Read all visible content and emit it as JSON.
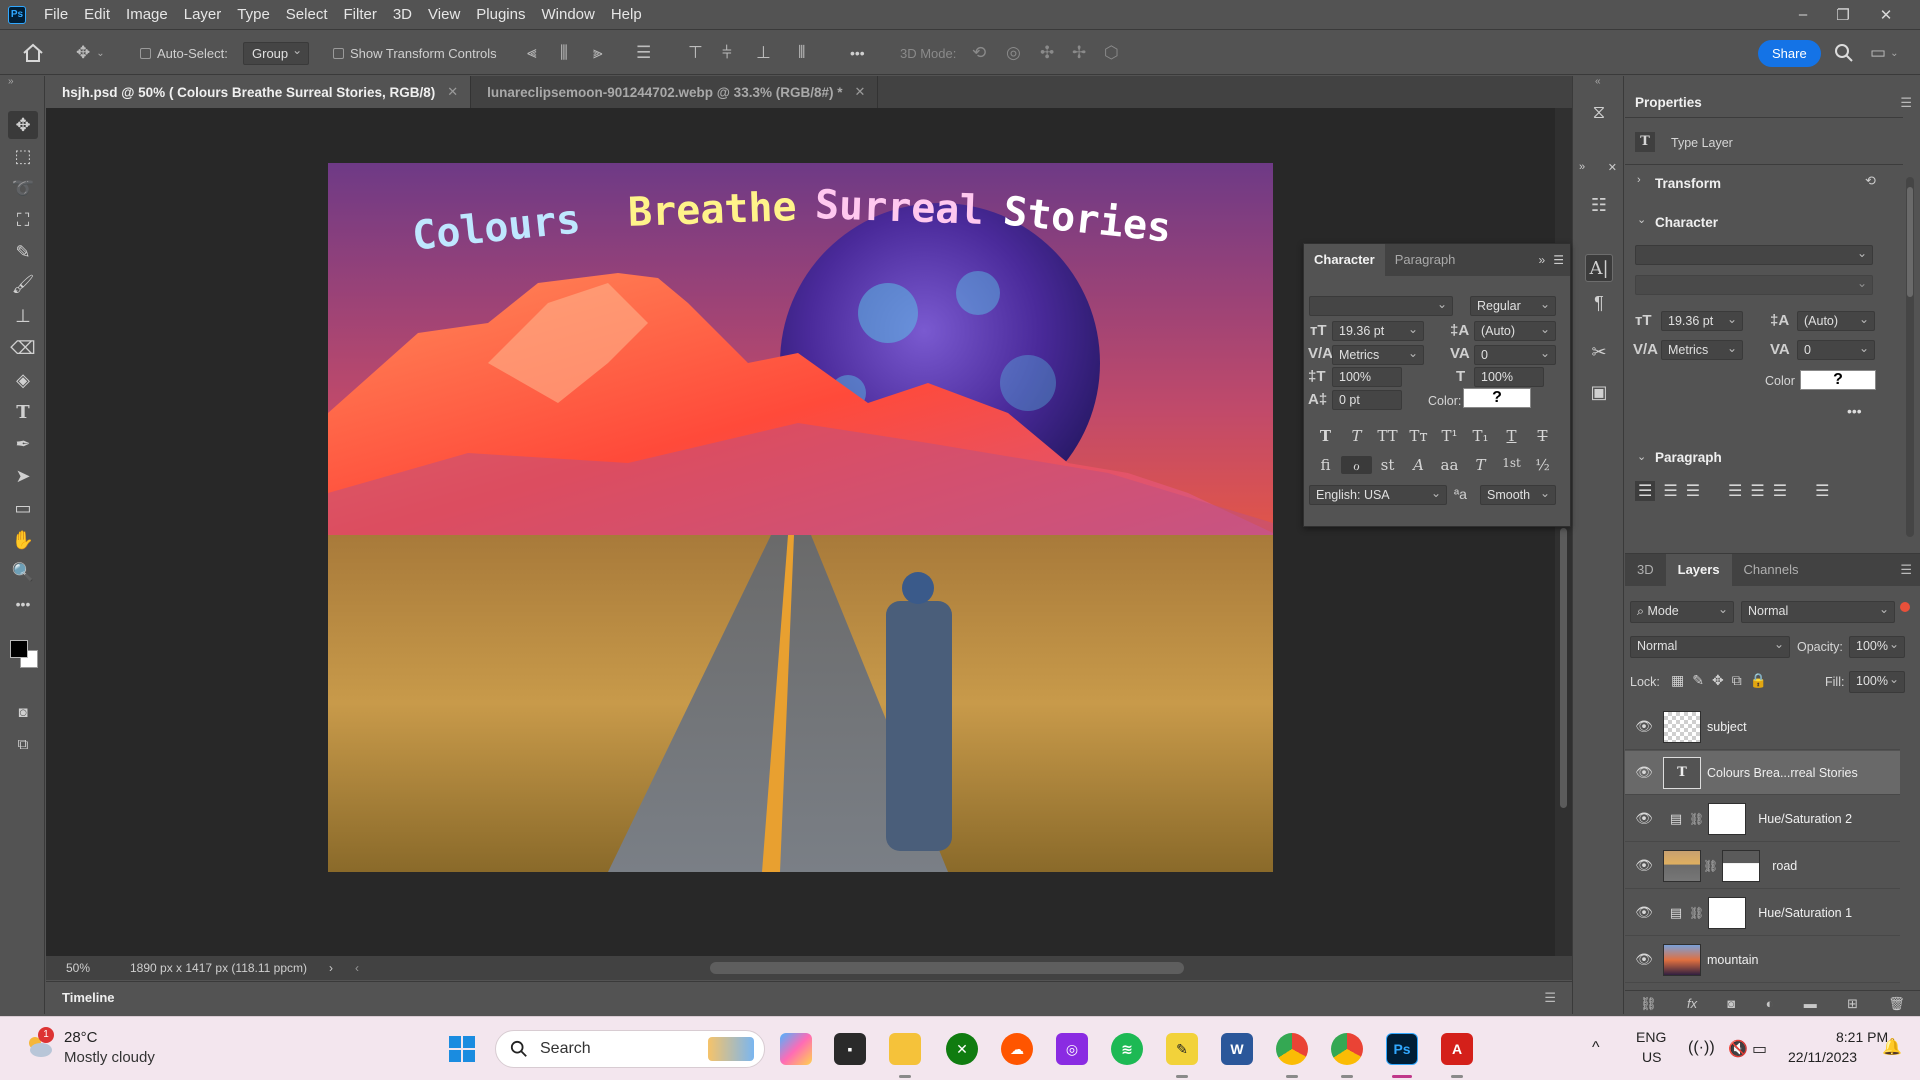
{
  "app": {
    "logo": "Ps",
    "menu": [
      "File",
      "Edit",
      "Image",
      "Layer",
      "Type",
      "Select",
      "Filter",
      "3D",
      "View",
      "Plugins",
      "Window",
      "Help"
    ]
  },
  "options": {
    "auto_select_label": "Auto-Select:",
    "auto_select_value": "Group",
    "transform_label": "Show Transform Controls",
    "more": "•••",
    "mode_3d": "3D Mode:",
    "share": "Share"
  },
  "tabs": [
    {
      "label": "hsjh.psd @ 50% ( Colours Breathe Surreal Stories, RGB/8)",
      "active": true
    },
    {
      "label": "lunareclipsemoon-901244702.webp @ 33.3% (RGB/8#) *",
      "active": false
    }
  ],
  "artwork": {
    "words": [
      "Colours",
      "Breathe",
      "Surreal",
      "Stories"
    ],
    "word_colors": [
      "#bfe7ff",
      "#fff38a",
      "#ffc8ef",
      "#ffffff"
    ]
  },
  "status": {
    "zoom": "50%",
    "doc_info": "1890 px x 1417 px (118.11 ppcm)"
  },
  "timeline": {
    "label": "Timeline"
  },
  "character_panel": {
    "tab_character": "Character",
    "tab_paragraph": "Paragraph",
    "font_family": "",
    "font_style": "Regular",
    "size": "19.36 pt",
    "leading": "(Auto)",
    "kerning": "Metrics",
    "tracking": "0",
    "vscale": "100%",
    "hscale": "100%",
    "baseline": "0 pt",
    "color_label": "Color:",
    "color_value": "?",
    "language": "English: USA",
    "antialias": "Smooth",
    "aa_icon": "ªa",
    "type_styles": [
      "T",
      "T",
      "TT",
      "Tт",
      "T¹",
      "T₁",
      "T",
      "T"
    ],
    "opentype": [
      "ﬁ",
      "ℴ",
      "st",
      "A",
      "aa",
      "T",
      "1st",
      "½"
    ]
  },
  "properties": {
    "title": "Properties",
    "layer_type": "Type Layer",
    "transform": "Transform",
    "character": "Character",
    "size": "19.36 pt",
    "leading": "(Auto)",
    "kerning": "Metrics",
    "tracking": "0",
    "color_label": "Color",
    "color_value": "?",
    "more": "•••",
    "paragraph": "Paragraph"
  },
  "layers_panel": {
    "tabs": [
      "3D",
      "Layers",
      "Channels"
    ],
    "active_tab": "Layers",
    "filter_label": "Mode",
    "filter_value": "Normal",
    "blend_mode": "Normal",
    "opacity_label": "Opacity:",
    "opacity": "100%",
    "lock_label": "Lock:",
    "fill_label": "Fill:",
    "fill": "100%",
    "layers": [
      {
        "name": "subject",
        "kind": "pixel-transparent",
        "selected": false
      },
      {
        "name": "Colours Brea...rreal Stories",
        "kind": "type",
        "selected": true
      },
      {
        "name": "Hue/Saturation 2",
        "kind": "adjustment",
        "selected": false
      },
      {
        "name": "road",
        "kind": "image-road",
        "selected": false
      },
      {
        "name": "Hue/Saturation 1",
        "kind": "adjustment",
        "selected": false
      },
      {
        "name": "mountain",
        "kind": "image-mountain",
        "selected": false
      }
    ]
  },
  "taskbar": {
    "weather_temp": "28°C",
    "weather_desc": "Mostly cloudy",
    "weather_badge": "1",
    "search": "Search",
    "lang_top": "ENG",
    "lang_bottom": "US",
    "time": "8:21 PM",
    "date": "22/11/2023"
  }
}
